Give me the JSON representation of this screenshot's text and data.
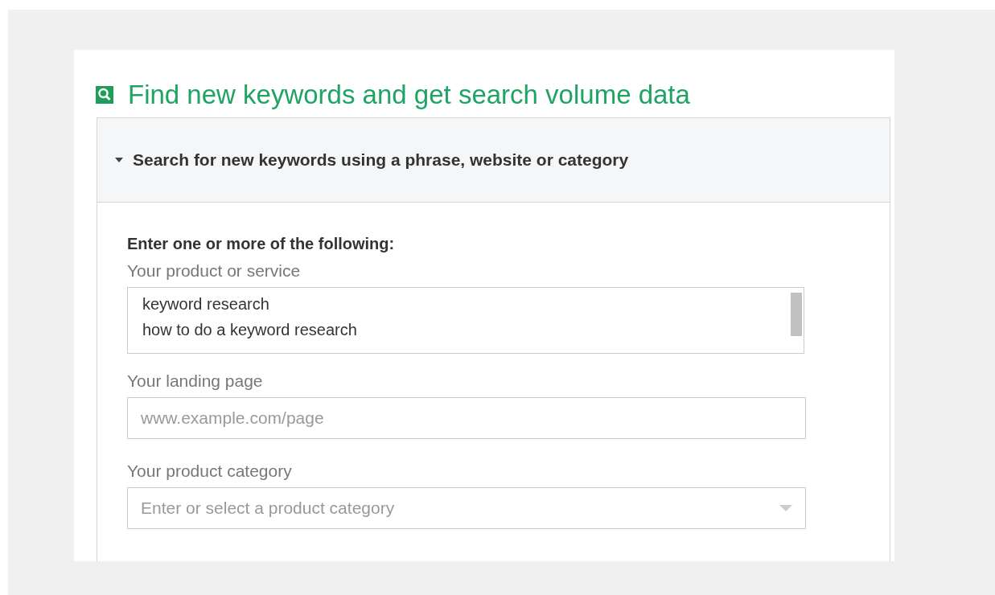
{
  "title": "Find new keywords and get search volume data",
  "section": {
    "title": "Search for new keywords using a phrase, website or category",
    "expanded": true
  },
  "form": {
    "intro": "Enter one or more of the following:",
    "product_label": "Your product or service",
    "product_lines": [
      "keyword research",
      "how to do a keyword research"
    ],
    "landing_label": "Your landing page",
    "landing_placeholder": "www.example.com/page",
    "category_label": "Your product category",
    "category_placeholder": "Enter or select a product category"
  }
}
